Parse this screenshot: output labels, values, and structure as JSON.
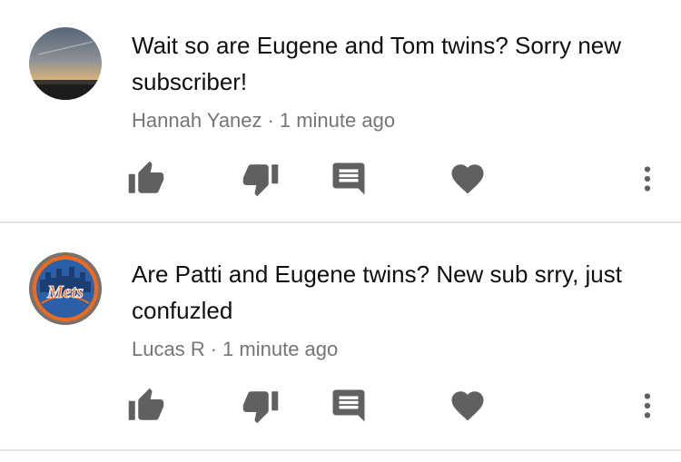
{
  "comments": [
    {
      "text": "Wait so are Eugene and Tom twins? Sorry new subscriber!",
      "author": "Hannah Yanez",
      "separator": "·",
      "time": "1 minute ago",
      "avatar_icon": "sunset-photo-avatar",
      "actions": [
        "thumbs-up-icon",
        "thumbs-down-icon",
        "reply-icon",
        "heart-icon",
        "more-vert-icon"
      ]
    },
    {
      "text": "Are Patti and Eugene twins? New sub srry, just confuzled",
      "author": "Lucas R",
      "separator": "·",
      "time": "1 minute ago",
      "avatar_logo_text": "Mets",
      "avatar_icon": "mets-logo-avatar",
      "actions": [
        "thumbs-up-icon",
        "thumbs-down-icon",
        "reply-icon",
        "heart-icon",
        "more-vert-icon"
      ]
    }
  ],
  "colors": {
    "icon": "#606060",
    "meta_text": "#757575",
    "comment_text": "#0f0f0f",
    "divider": "#e3e3e3",
    "mets_orange": "#f06a1d",
    "mets_blue": "#1d4a8c"
  }
}
